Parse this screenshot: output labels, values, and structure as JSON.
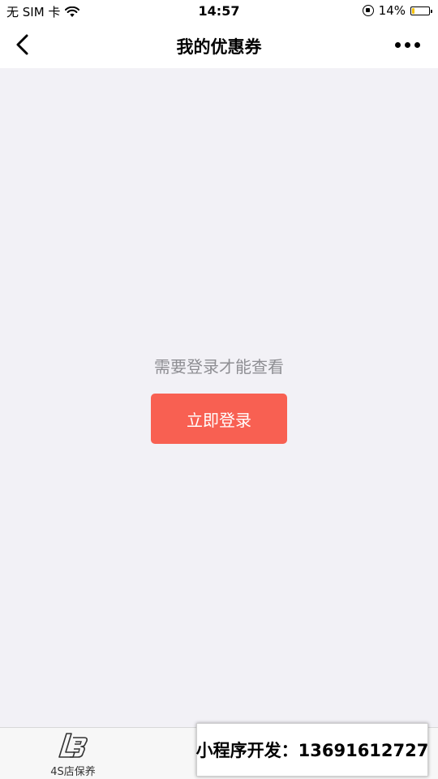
{
  "status_bar": {
    "carrier": "无 SIM 卡",
    "time": "14:57",
    "battery_percent_text": "14%",
    "battery_level": 0.14,
    "icons": [
      "wifi-icon",
      "orientation-lock-icon",
      "battery-icon"
    ]
  },
  "nav": {
    "title": "我的优惠券",
    "back_icon": "chevron-left-icon",
    "more_icon": "more-dots-icon"
  },
  "main": {
    "prompt": "需要登录才能查看",
    "login_button_label": "立即登录"
  },
  "tab_bar": {
    "items": [
      {
        "label": "4S店保养",
        "icon": "brand-logo-icon"
      }
    ]
  },
  "promo": {
    "text": "小程序开发：13691612727"
  },
  "colors": {
    "background": "#f2f1f6",
    "button": "#f86052",
    "prompt_text": "#8e8e93",
    "battery_fill": "#f5c000"
  }
}
